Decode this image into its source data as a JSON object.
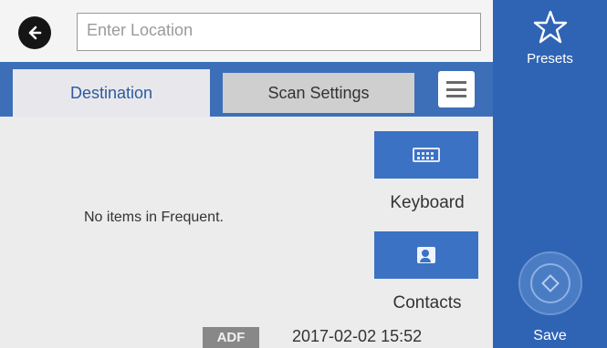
{
  "location": {
    "placeholder": "Enter Location"
  },
  "tabs": [
    {
      "label": "Destination",
      "active": true
    },
    {
      "label": "Scan Settings",
      "active": false
    }
  ],
  "content": {
    "empty_message": "No items in Frequent.",
    "keyboard_label": "Keyboard",
    "contacts_label": "Contacts"
  },
  "status": {
    "source_badge": "ADF",
    "datetime": "2017-02-02 15:52"
  },
  "sidebar": {
    "presets_label": "Presets",
    "save_label": "Save"
  },
  "colors": {
    "accent_blue": "#3c6fb8",
    "sidebar_blue": "#2f64b4",
    "button_blue": "#3b72c4"
  },
  "icons": [
    "back-arrow-icon",
    "menu-icon",
    "keyboard-icon",
    "contacts-icon",
    "star-icon",
    "start-icon"
  ]
}
